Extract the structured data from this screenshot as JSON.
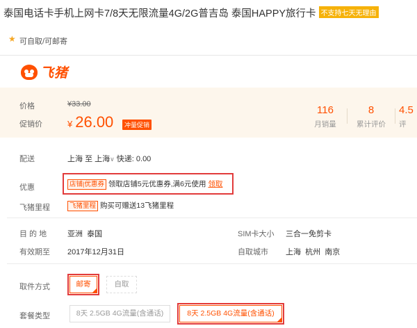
{
  "product": {
    "title": "泰国电话卡手机上网卡7/8天无限流量4G/2G普吉岛 泰国HAPPY旅行卡",
    "title_badge": "不支持七天无理由",
    "pickup_note": "可自取/可邮寄"
  },
  "brand": {
    "logo_text": "飞猪"
  },
  "price": {
    "label": "价格",
    "original": "¥33.00",
    "promo_label": "促销价",
    "currency": "¥",
    "current": "26.00",
    "promo_tag": "冲量促销"
  },
  "stats": [
    {
      "num": "116",
      "txt": "月销量"
    },
    {
      "num": "8",
      "txt": "累计评价"
    },
    {
      "num": "4.5",
      "txt": "评"
    }
  ],
  "delivery": {
    "label": "配送",
    "from": "上海",
    "to_word": "至",
    "to": "上海",
    "chevron": "∨",
    "shipping": "快递: 0.00"
  },
  "coupon": {
    "label": "优惠",
    "tag1": "店铺",
    "tag2": "优惠券",
    "text": "领取店铺5元优惠券,满6元使用",
    "claim": "领取"
  },
  "miles": {
    "label": "飞猪里程",
    "tag": "飞猪里程",
    "text": "购买可赠送13飞猪里程"
  },
  "info": {
    "destination_label": "目 的 地",
    "destination": "亚洲  泰国",
    "sim_label": "SIM卡大小",
    "sim": "三合一免剪卡",
    "valid_label": "有效期至",
    "valid": "2017年12月31日",
    "pickup_city_label": "自取城市",
    "pickup_city": "上海  杭州  南京"
  },
  "pickup_method": {
    "label": "取件方式",
    "options": [
      "邮寄",
      "自取"
    ]
  },
  "package_type": {
    "label": "套餐类型",
    "options": [
      "8天 2.5GB 4G流量(含通话)",
      "8天 2.5GB 4G流量(含通话)"
    ]
  },
  "colors": {
    "accent": "#ff5000",
    "highlight_red": "#e23a3a",
    "badge_yellow": "#f6b20a",
    "price_bg": "#fdf6ec"
  }
}
